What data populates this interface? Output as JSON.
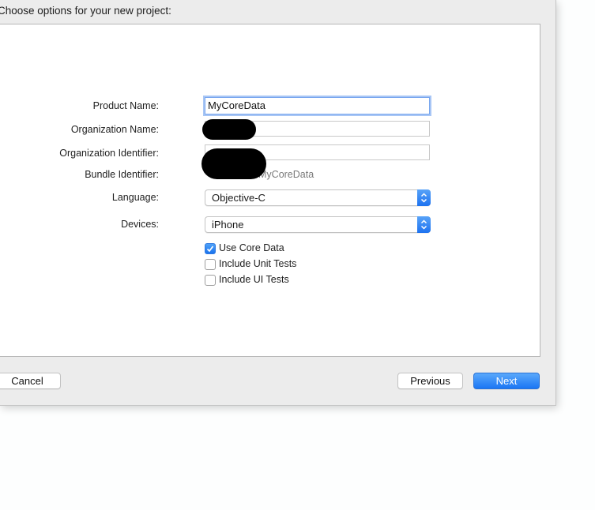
{
  "dialog": {
    "title": "Choose options for your new project:",
    "product_name_label": "Product Name:",
    "product_name_value": "MyCoreData",
    "org_name_label": "Organization Name:",
    "org_name_value": "",
    "org_id_label": "Organization Identifier:",
    "org_id_value": "",
    "bundle_id_label": "Bundle Identifier:",
    "bundle_id_value": "MyCoreData",
    "language_label": "Language:",
    "language_value": "Objective-C",
    "devices_label": "Devices:",
    "devices_value": "iPhone",
    "checkboxes": [
      {
        "label": "Use Core Data",
        "checked": true
      },
      {
        "label": "Include Unit Tests",
        "checked": false
      },
      {
        "label": "Include UI Tests",
        "checked": false
      }
    ]
  },
  "buttons": {
    "cancel": "Cancel",
    "previous": "Previous",
    "next": "Next"
  },
  "colors": {
    "accent": "#1b76f4",
    "redaction": "#000000"
  }
}
